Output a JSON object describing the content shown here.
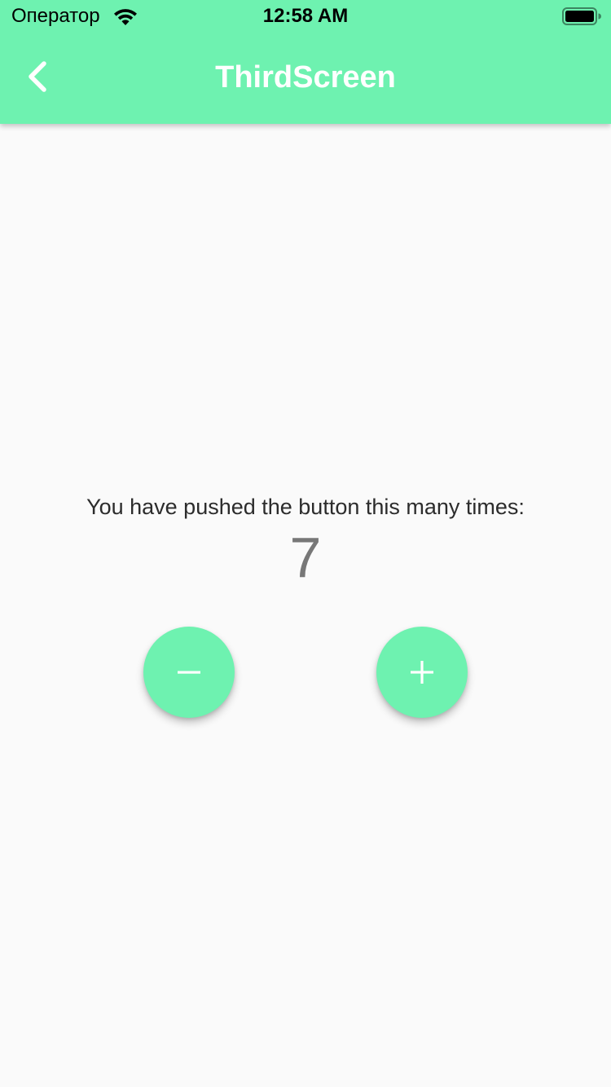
{
  "status_bar": {
    "carrier": "Оператор",
    "time": "12:58 AM",
    "wifi_icon": "wifi-icon",
    "battery_icon": "battery-icon"
  },
  "app_bar": {
    "title": "ThirdScreen",
    "back_icon": "chevron-left-icon",
    "background_color": "#6ef2b0"
  },
  "body": {
    "message": "You have pushed the button this many times:",
    "counter": "7"
  },
  "actions": {
    "decrement_icon": "minus-icon",
    "increment_icon": "plus-icon",
    "fab_color": "#6ef2b0"
  }
}
